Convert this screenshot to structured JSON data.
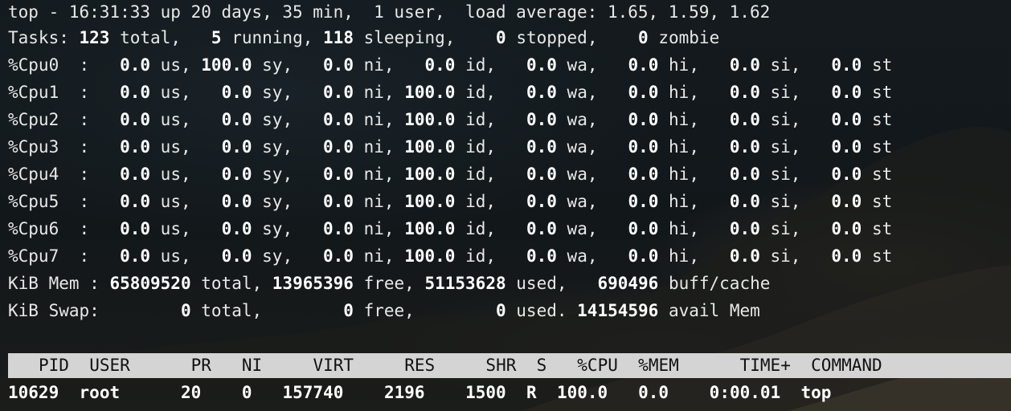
{
  "summary": {
    "line1": "top - 16:31:33 up 20 days, 35 min,  1 user,  load average: 1.65, 1.59, 1.62",
    "tasks": {
      "label": "Tasks:",
      "total": "123",
      "total_label": "total,",
      "running": "5",
      "running_label": "running,",
      "sleeping": "118",
      "sleeping_label": "sleeping,",
      "stopped": "0",
      "stopped_label": "stopped,",
      "zombie": "0",
      "zombie_label": "zombie"
    },
    "cpus": [
      {
        "name": "%Cpu0",
        "us": "0.0",
        "sy": "100.0",
        "ni": "0.0",
        "id": "0.0",
        "wa": "0.0",
        "hi": "0.0",
        "si": "0.0",
        "st": "0.0"
      },
      {
        "name": "%Cpu1",
        "us": "0.0",
        "sy": "0.0",
        "ni": "0.0",
        "id": "100.0",
        "wa": "0.0",
        "hi": "0.0",
        "si": "0.0",
        "st": "0.0"
      },
      {
        "name": "%Cpu2",
        "us": "0.0",
        "sy": "0.0",
        "ni": "0.0",
        "id": "100.0",
        "wa": "0.0",
        "hi": "0.0",
        "si": "0.0",
        "st": "0.0"
      },
      {
        "name": "%Cpu3",
        "us": "0.0",
        "sy": "0.0",
        "ni": "0.0",
        "id": "100.0",
        "wa": "0.0",
        "hi": "0.0",
        "si": "0.0",
        "st": "0.0"
      },
      {
        "name": "%Cpu4",
        "us": "0.0",
        "sy": "0.0",
        "ni": "0.0",
        "id": "100.0",
        "wa": "0.0",
        "hi": "0.0",
        "si": "0.0",
        "st": "0.0"
      },
      {
        "name": "%Cpu5",
        "us": "0.0",
        "sy": "0.0",
        "ni": "0.0",
        "id": "100.0",
        "wa": "0.0",
        "hi": "0.0",
        "si": "0.0",
        "st": "0.0"
      },
      {
        "name": "%Cpu6",
        "us": "0.0",
        "sy": "0.0",
        "ni": "0.0",
        "id": "100.0",
        "wa": "0.0",
        "hi": "0.0",
        "si": "0.0",
        "st": "0.0"
      },
      {
        "name": "%Cpu7",
        "us": "0.0",
        "sy": "0.0",
        "ni": "0.0",
        "id": "100.0",
        "wa": "0.0",
        "hi": "0.0",
        "si": "0.0",
        "st": "0.0"
      }
    ],
    "mem": {
      "label": "KiB Mem :",
      "total": "65809520",
      "total_label": "total,",
      "free": "13965396",
      "free_label": "free,",
      "used": "51153628",
      "used_label": "used,",
      "buff": "690496",
      "buff_label": "buff/cache"
    },
    "swap": {
      "label": "KiB Swap:",
      "total": "0",
      "total_label": "total,",
      "free": "0",
      "free_label": "free,",
      "used": "0",
      "used_label": "used.",
      "avail": "14154596",
      "avail_label": "avail Mem"
    }
  },
  "process_table": {
    "columns": [
      "PID",
      "USER",
      "PR",
      "NI",
      "VIRT",
      "RES",
      "SHR",
      "S",
      "%CPU",
      "%MEM",
      "TIME+",
      "COMMAND"
    ],
    "rows": [
      {
        "PID": "10629",
        "USER": "root",
        "PR": "20",
        "NI": "0",
        "VIRT": "157740",
        "RES": "2196",
        "SHR": "1500",
        "S": "R",
        "%CPU": "100.0",
        "%MEM": "0.0",
        "TIME+": "0:00.01",
        "COMMAND": "top"
      }
    ]
  },
  "colors": {
    "foreground": "#e8e8e8",
    "bold": "#ffffff",
    "header_bar_bg": "#d4d4d4",
    "header_bar_fg": "#111111"
  }
}
